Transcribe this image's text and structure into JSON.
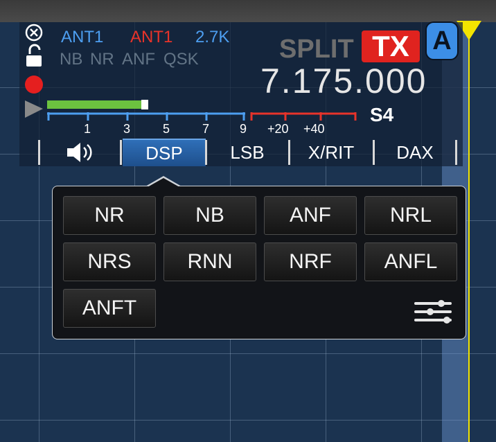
{
  "status": {
    "ant_rx": "ANT1",
    "ant_tx": "ANT1",
    "filter_width": "2.7K",
    "nb_flags": [
      "NB",
      "NR",
      "ANF",
      "QSK"
    ],
    "split_label": "SPLIT",
    "tx_label": "TX",
    "slice_letter": "A",
    "frequency": "7.175.000",
    "s_level": "S4",
    "signal_fraction": 0.5
  },
  "meter_scale": [
    "1",
    "3",
    "5",
    "7",
    "9",
    "+20",
    "+40"
  ],
  "tabs": [
    {
      "label": "DSP"
    },
    {
      "label": "LSB"
    },
    {
      "label": "X/RIT"
    },
    {
      "label": "DAX"
    }
  ],
  "dsp_buttons": [
    "NR",
    "NB",
    "ANF",
    "NRL",
    "NRS",
    "RNN",
    "NRF",
    "ANFL",
    "ANFT"
  ],
  "icons": {
    "close": "close-circle-icon",
    "lock": "unlock-icon",
    "record": "record-icon",
    "play": "play-icon",
    "audio": "speaker-icon",
    "settings": "sliders-icon"
  },
  "colors": {
    "ant_rx": "#4d9ef0",
    "ant_tx": "#e8332a",
    "width": "#4d9ef0",
    "tx_bg": "#e0231f",
    "slice_bg": "#3c8ee6",
    "tab_active": "#2f6fb8"
  }
}
